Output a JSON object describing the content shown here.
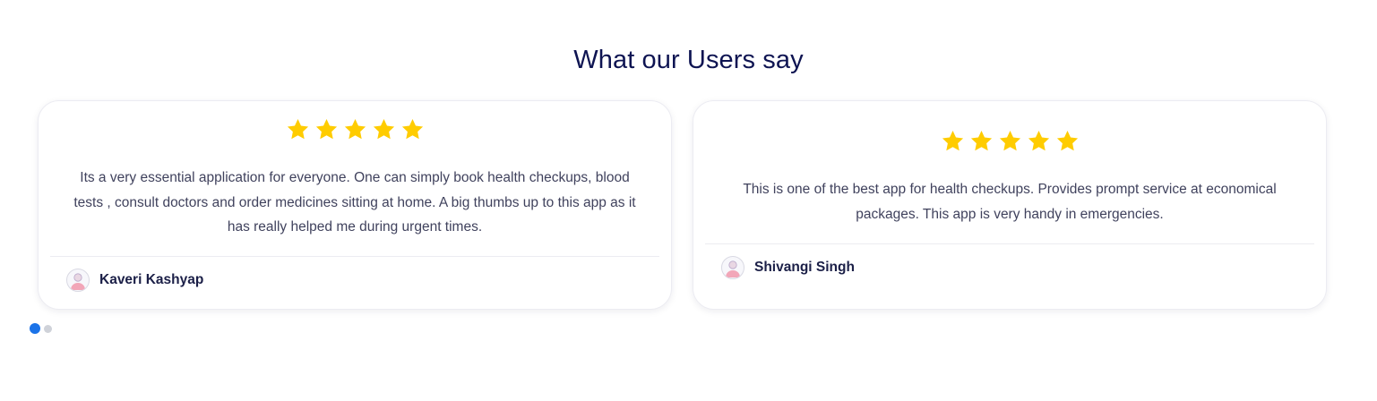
{
  "section": {
    "title": "What our Users say"
  },
  "colors": {
    "title": "#0e1452",
    "star": "#ffcc00",
    "text": "#40425d",
    "name": "#1b1f47",
    "dot_active": "#1b73e8",
    "dot_inactive": "#cfd2d9"
  },
  "testimonials": [
    {
      "rating": 5,
      "text": "Its a very essential application for everyone. One can simply book health checkups, blood tests , consult doctors and order medicines sitting at home. A big thumbs up to this app as it has really helped me during urgent times.",
      "author": "Kaveri Kashyap",
      "avatar_icon": "user-avatar-icon"
    },
    {
      "rating": 5,
      "text": "This is one of the best app for health checkups. Provides prompt service at economical packages. This app is very handy in emergencies.",
      "author": "Shivangi Singh",
      "avatar_icon": "user-avatar-icon"
    }
  ],
  "carousel": {
    "pages": 2,
    "active_page": 1
  }
}
